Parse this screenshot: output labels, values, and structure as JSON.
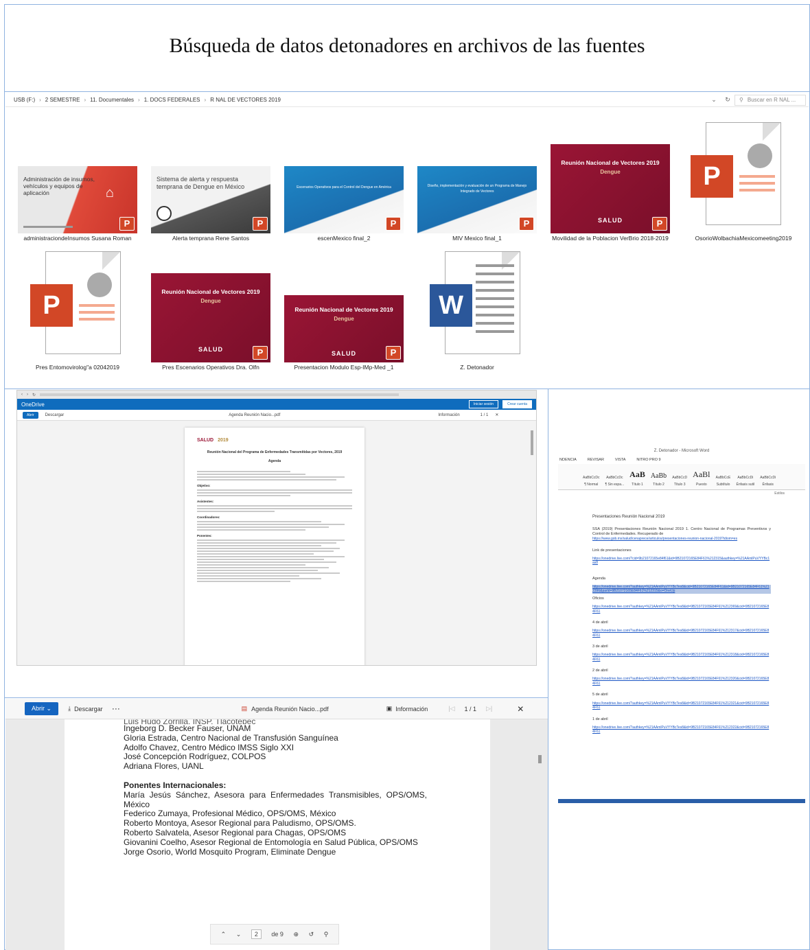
{
  "title": "Búsqueda de datos detonadores en archivos de las fuentes",
  "explorer": {
    "breadcrumbs": [
      "USB (F:)",
      "2 SEMESTRE",
      "11. Documentales",
      "1. DOCS FEDERALES",
      "R NAL DE VECTORES 2019"
    ],
    "search_placeholder": "Buscar en R NAL ...",
    "files": [
      {
        "name": "administraciondeInsumos Susana Roman",
        "thumb_text": "Administración de insumos, vehículos y equipos de aplicación"
      },
      {
        "name": "Alerta temprana Rene Santos",
        "thumb_text": "Sistema de alerta y respuesta temprana de Dengue en México"
      },
      {
        "name": "escenMexico final_2",
        "thumb_text": "Escenarios Operativos para el Control del Dengue en América"
      },
      {
        "name": "MIV Mexico final_1",
        "thumb_text": "Diseño, implementación y evaluación de un Programa de Manejo Integrado de Vectores"
      },
      {
        "name": "Movilidad de la Poblacion VerBrio 2018-2019",
        "thumb_title": "Reunión Nacional de Vectores 2019",
        "thumb_sub": "Dengue",
        "thumb_salud": "SALUD"
      },
      {
        "name": "OsorioWolbachiaMexicomeeting2019"
      },
      {
        "name": "Pres Entomovirolog\"a 02042019"
      },
      {
        "name": "Pres Escenarios Operativos Dra. Olfn",
        "thumb_title": "Reunión Nacional de Vectores 2019",
        "thumb_sub": "Dengue",
        "thumb_salud": "SALUD"
      },
      {
        "name": "Presentacion Modulo Esp-IMp-Med _1",
        "thumb_title": "Reunión Nacional de Vectores 2019",
        "thumb_sub": "Dengue",
        "thumb_salud": "SALUD"
      },
      {
        "name": "Z. Detonador"
      }
    ]
  },
  "onedrive": {
    "app": "OneDrive",
    "open": "Abrir",
    "download": "Descargar",
    "file": "Agenda Reunión Nacio...pdf",
    "info": "Información",
    "page": "1 / 1",
    "btn_signin": "Iniciar sesión",
    "btn_create": "Crear cuenta",
    "pdf": {
      "brand": "SALUD",
      "year": "2019",
      "heading": "Reunión Nacional del Programa de Enfermedades Transmitidas por Vectores, 2019",
      "sub": "Agenda",
      "labels": [
        "Objetivo:",
        "Asistentes:",
        "Coordinadores:",
        "Ponentes:"
      ]
    }
  },
  "word": {
    "window_title": "Z. Detonador - Microsoft Word",
    "tabs": [
      "NDENCIA",
      "REVISAR",
      "VISTA",
      "NITRO PRO 9"
    ],
    "styles": [
      {
        "sample": "AaBbCcDc",
        "name": "¶ Normal"
      },
      {
        "sample": "AaBbCcDc",
        "name": "¶ Sin espa..."
      },
      {
        "sample": "AaB",
        "name": "Título 1"
      },
      {
        "sample": "AaBb",
        "name": "Título 2"
      },
      {
        "sample": "AaBbCcD",
        "name": "Título 3"
      },
      {
        "sample": "AaBl",
        "name": "Puesto"
      },
      {
        "sample": "AaBbCcE",
        "name": "Subtítulo"
      },
      {
        "sample": "AaBbCcDi",
        "name": "Énfasis sutil"
      },
      {
        "sample": "AaBbCcDi",
        "name": "Énfasis"
      }
    ],
    "ribbon_group": "Estilos",
    "heading": "Presentaciones Reunión Nacional 2019",
    "reference": "SSA (2019) Presentaciones Reunión Nacional 2019 1. Centro Nacional de Programas Preventivos y Control de Enfermedades. Recuperado de",
    "ref_link": "https://www.gob.mx/salud/cenaprece/articulos/presentaciones-reunion-nacional-2019?idiom=es",
    "link_label": "Link de presentaciones",
    "link1": "https://onedrive.live.com/?cid=9b21072165e84f61&id=9B21072165E84F61%212315&authkey=%21AAmlPuVYYBc1as8",
    "agenda_label": "Agenda",
    "agenda_link": "https://onedrive.live.com/?authkey=%21AAmlPuVYYBcTes8&cid=9B21072165E84F61&id=9B21072165E84F61%212396&parld=9B21072165E84F61%212315&o=OneUp",
    "entries": [
      {
        "label": "Oficios",
        "link": "https://onedrive.live.com/?authkey=%21AAmlPuVYYBcTes8&id=9B21072165E84F61%212369&cid=9B21072165E84F61"
      },
      {
        "label": "4 de abril",
        "link": "https://onedrive.live.com/?authkey=%21AAmlPuVYYBcTes8&id=9B21072165E84F61%212317&cid=9B21072165E84F61"
      },
      {
        "label": "3 de abril",
        "link": "https://onedrive.live.com/?authkey=%21AAmlPuVYYBcTes8&id=9B21072165E84F61%212318&cid=9B21072165E84F61"
      },
      {
        "label": "2 de abril",
        "link": "https://onedrive.live.com/?authkey=%21AAmlPuVYYBcTes8&id=9B21072165E84F61%212320&cid=9B21072165E84F61"
      },
      {
        "label": "5 de abril",
        "link": "https://onedrive.live.com/?authkey=%21AAmlPuVYYBcTes8&id=9B21072165E84F61%212321&cid=9B21072165E84F61"
      },
      {
        "label": "1 de abril",
        "link": "https://onedrive.live.com/?authkey=%21AAmlPuVYYBcTes8&id=9B21072165E84F61%212322&cid=9B21072165E84F61"
      }
    ]
  },
  "zoom": {
    "open": "Abrir",
    "download": "Descargar",
    "more": "···",
    "file": "Agenda Reunión Nacio...pdf",
    "info": "Información",
    "page": "1 / 1",
    "cut_line": "Luis Hugo Zorrilla, INSP, Tlacotepec",
    "names": [
      "Ingeborg D. Becker Fauser, UNAM",
      "Gloria Estrada, Centro Nacional de Transfusión Sanguínea",
      "Adolfo Chavez, Centro Médico IMSS Siglo XXI",
      "José Concepción Rodríguez, COLPOS",
      "Adriana Flores, UANL"
    ],
    "intl_heading": "Ponentes Internacionales:",
    "intl": [
      "María Jesús Sánchez, Asesora para Enfermedades Transmisibles, OPS/OMS, México",
      "Federico Zumaya, Profesional Médico, OPS/OMS, México",
      "Roberto Montoya, Asesor Regional para Paludismo, OPS/OMS.",
      "Roberto Salvatela, Asesor Regional para Chagas, OPS/OMS",
      "Giovanini Coelho, Asesor Regional de Entomología en Salud Pública, OPS/OMS",
      "Jorge Osorio, World Mosquito Program, Eliminate Dengue"
    ],
    "pager_current": "2",
    "pager_total": "de 9"
  }
}
